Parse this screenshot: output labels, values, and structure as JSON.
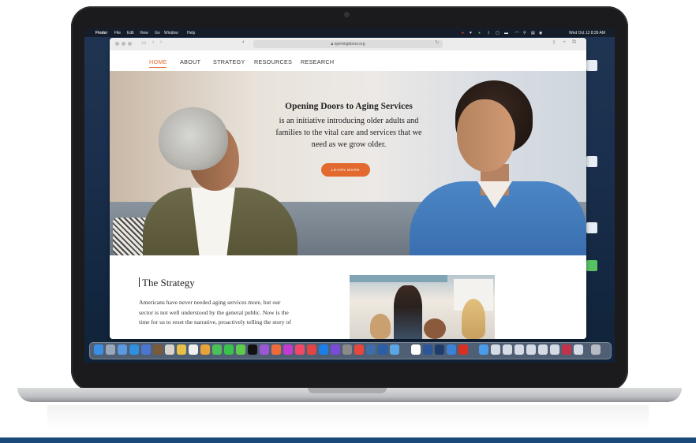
{
  "menubar": {
    "finder": "Finder",
    "menus": [
      "File",
      "Edit",
      "View",
      "Go",
      "Window",
      "Help"
    ],
    "clock": "Wed Oct 13  8:39 AM"
  },
  "browser": {
    "url": "openingdoors.org"
  },
  "nav": {
    "items": [
      "HOME",
      "ABOUT",
      "STRATEGY",
      "RESOURCES",
      "RESEARCH"
    ]
  },
  "hero": {
    "title": "Opening Doors to Aging Services",
    "text_line1": "is an initiative introducing older adults and",
    "text_line2": "families to the vital care and services that we",
    "text_line3": "need as we grow older.",
    "cta": "LEARN MORE"
  },
  "strategy": {
    "title": "The Strategy",
    "line1": "Americans have never needed aging services more, but our",
    "line2": "sector is not well understood by the general public. Now is the",
    "line3": "time for us to reset the narrative, proactively telling the story of"
  },
  "colors": {
    "accent": "#e36a2e",
    "dock_blue": "#1c4a78"
  }
}
